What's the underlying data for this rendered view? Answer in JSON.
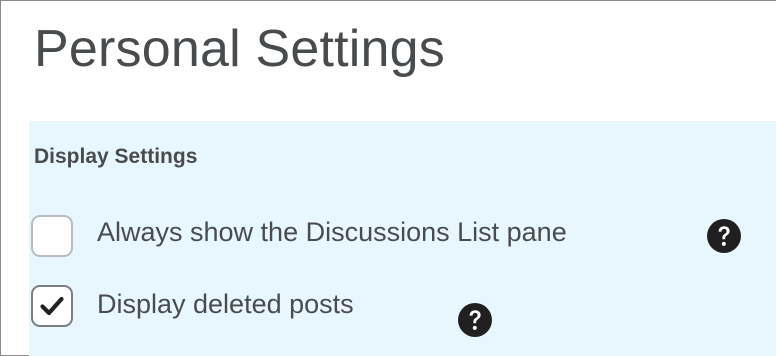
{
  "page": {
    "title": "Personal Settings"
  },
  "display_settings": {
    "heading": "Display Settings",
    "options": [
      {
        "label": "Always show the Discussions List pane",
        "checked": false,
        "help_icon": "question-circle-icon"
      },
      {
        "label": "Display deleted posts",
        "checked": true,
        "help_icon": "question-circle-icon"
      }
    ]
  },
  "colors": {
    "panel_background": "#e8f6fd",
    "text": "#494c4e",
    "icon": "#202020"
  }
}
